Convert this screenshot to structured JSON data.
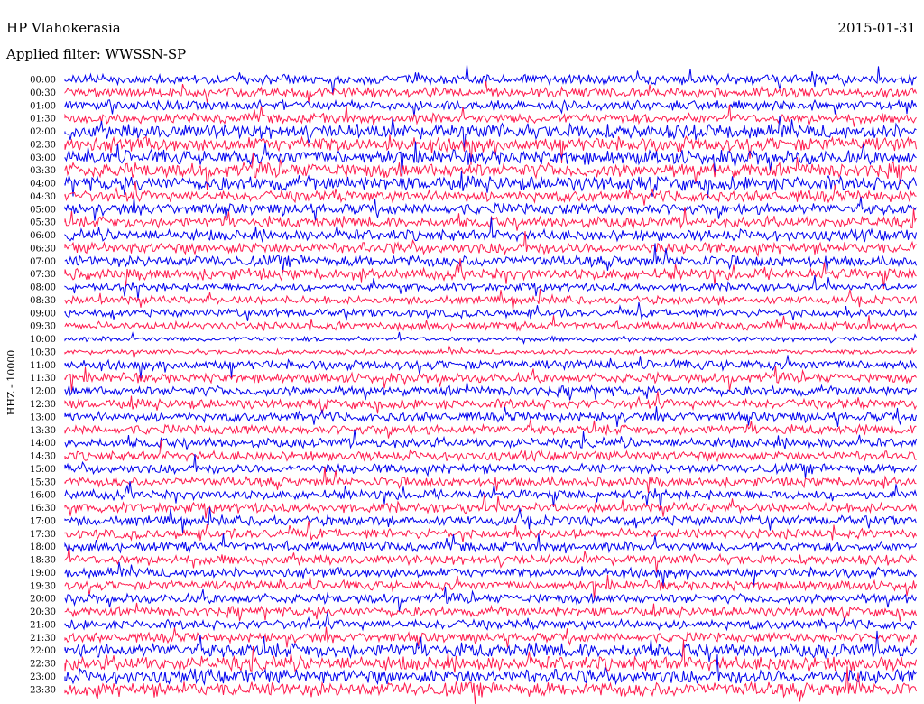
{
  "header": {
    "station": "HP Vlahokerasia",
    "date": "2015-01-31",
    "filter": "Applied filter: WWSSN-SP"
  },
  "chart_data": {
    "type": "line",
    "title": "HP Vlahokerasia",
    "subtitle": "Applied filter: WWSSN-SP",
    "date": "2015-01-31",
    "ylabel": "HHZ - 10000",
    "xlabel": "",
    "row_labels": [
      "00:00",
      "00:30",
      "01:00",
      "01:30",
      "02:00",
      "02:30",
      "03:00",
      "03:30",
      "04:00",
      "04:30",
      "05:00",
      "05:30",
      "06:00",
      "06:30",
      "07:00",
      "07:30",
      "08:00",
      "08:30",
      "09:00",
      "09:30",
      "10:00",
      "10:30",
      "11:00",
      "11:30",
      "12:00",
      "12:30",
      "13:00",
      "13:30",
      "14:00",
      "14:30",
      "15:00",
      "15:30",
      "16:00",
      "16:30",
      "17:00",
      "17:30",
      "18:00",
      "18:30",
      "19:00",
      "19:30",
      "20:00",
      "20:30",
      "21:00",
      "21:30",
      "22:00",
      "22:30",
      "23:00",
      "23:30"
    ],
    "row_colors": [
      "#0000ee",
      "#ff1a4d"
    ],
    "grid": false,
    "legend": "none"
  }
}
